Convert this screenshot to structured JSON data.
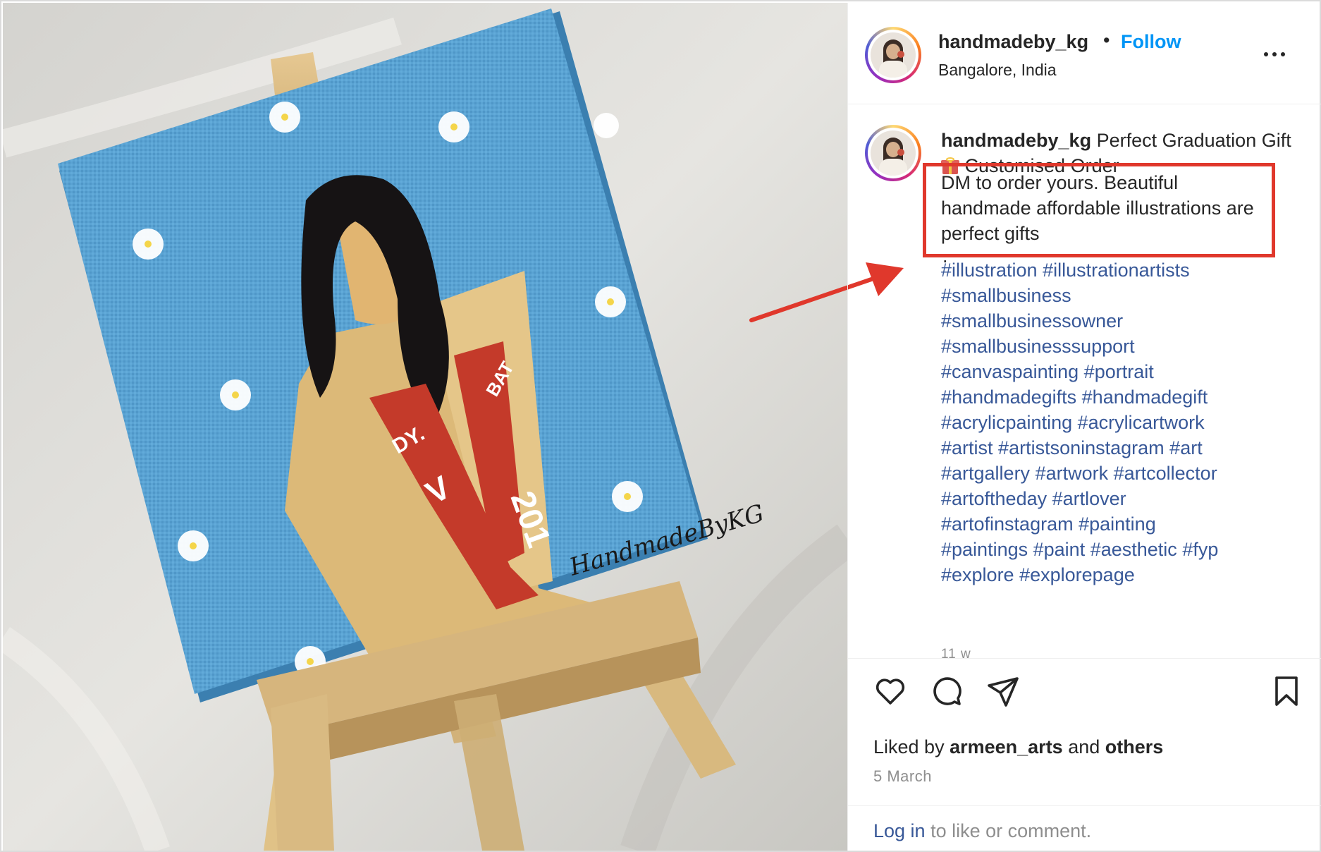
{
  "header": {
    "username": "handmadeby_kg",
    "separator": "•",
    "follow_label": "Follow",
    "location": "Bangalore, India",
    "more_icon": "more-horizontal-icon"
  },
  "caption": {
    "username": "handmadeby_kg",
    "text_part1": "Perfect Graduation Gift",
    "gift_icon": "gift-emoji",
    "text_part2": "Customised Order",
    "highlight_text": "DM to order yours. Beautiful handmade affordable illustrations are perfect gifts",
    "period": ".",
    "hashtag_lines": [
      [
        "#illustration",
        "#illustrationartists"
      ],
      [
        "#smallbusiness"
      ],
      [
        "#smallbusinessowner"
      ],
      [
        "#smallbusinesssupport"
      ],
      [
        "#canvaspainting",
        "#portrait"
      ],
      [
        "#handmadegifts",
        "#handmadegift"
      ],
      [
        "#acrylicpainting",
        "#acrylicartwork"
      ],
      [
        "#artist",
        "#artistsoninstagram",
        "#art"
      ],
      [
        "#artgallery",
        "#artwork",
        "#artcollector"
      ],
      [
        "#artoftheday",
        "#artlover"
      ],
      [
        "#artofinstagram",
        "#painting"
      ],
      [
        "#paintings",
        "#paint",
        "#aesthetic",
        "#fyp"
      ],
      [
        "#explore",
        "#explorepage"
      ]
    ],
    "age": "11 w"
  },
  "actions": {
    "like_icon": "heart-icon",
    "comment_icon": "comment-icon",
    "share_icon": "send-icon",
    "save_icon": "bookmark-icon"
  },
  "likes": {
    "prefix": "Liked by",
    "user": "armeen_arts",
    "conj": "and",
    "others": "others"
  },
  "date": "5 March",
  "login": {
    "link": "Log in",
    "rest": "to like or comment."
  },
  "photo": {
    "sash_left": "DY.",
    "sash_right": "BAT",
    "year_left": "V",
    "year_right": "201",
    "signature": "HandmadeByKG"
  },
  "colors": {
    "follow": "#0095f6",
    "hashtag": "#385898",
    "highlight_border": "#e0382c",
    "canvas_blue": "#5aa3d3"
  }
}
